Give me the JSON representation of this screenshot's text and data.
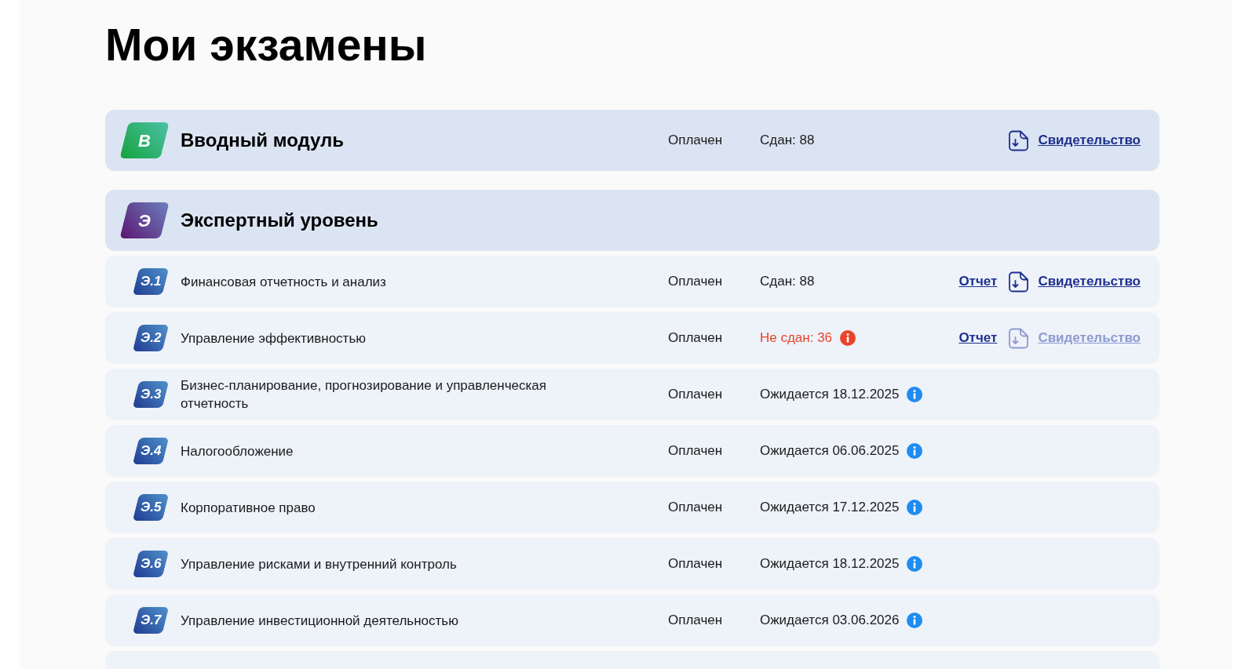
{
  "title": "Мои экзамены",
  "sections": [
    {
      "kind": "module",
      "color": "#16a23e",
      "badge": "В",
      "title": "Вводный модуль",
      "status": "Оплачен",
      "result": {
        "kind": "passed",
        "text": "Сдан: 88"
      },
      "certificate": {
        "label": "Свидетельство",
        "disabled": false
      }
    },
    {
      "kind": "module",
      "color": "#5c1470",
      "badge": "Э",
      "title": "Экспертный уровень"
    },
    {
      "kind": "exam",
      "color": "#1f3a90",
      "badge": "Э.1",
      "title": "Финансовая отчетность и анализ",
      "status": "Оплачен",
      "result": {
        "kind": "passed",
        "text": "Сдан: 88"
      },
      "report": "Отчет",
      "certificate": {
        "label": "Свидетельство",
        "disabled": false
      }
    },
    {
      "kind": "exam",
      "color": "#1f3a90",
      "badge": "Э.2",
      "title": "Управление эффективностью",
      "status": "Оплачен",
      "result": {
        "kind": "failed",
        "text": "Не сдан: 36"
      },
      "report": "Отчет",
      "certificate": {
        "label": "Свидетельство",
        "disabled": true
      }
    },
    {
      "kind": "exam",
      "color": "#1f3a90",
      "badge": "Э.3",
      "title": "Бизнес-планирование, прогнозирование и управленческая отчетность",
      "status": "Оплачен",
      "result": {
        "kind": "pending",
        "text": "Ожидается 18.12.2025"
      }
    },
    {
      "kind": "exam",
      "color": "#1f3a90",
      "badge": "Э.4",
      "title": "Налогообложение",
      "status": "Оплачен",
      "result": {
        "kind": "pending",
        "text": "Ожидается 06.06.2025"
      }
    },
    {
      "kind": "exam",
      "color": "#1f3a90",
      "badge": "Э.5",
      "title": "Корпоративное право",
      "status": "Оплачен",
      "result": {
        "kind": "pending",
        "text": "Ожидается 17.12.2025"
      }
    },
    {
      "kind": "exam",
      "color": "#1f3a90",
      "badge": "Э.6",
      "title": "Управление рисками и внутренний контроль",
      "status": "Оплачен",
      "result": {
        "kind": "pending",
        "text": "Ожидается 18.12.2025"
      }
    },
    {
      "kind": "exam",
      "color": "#1f3a90",
      "badge": "Э.7",
      "title": "Управление инвестиционной деятельностью",
      "status": "Оплачен",
      "result": {
        "kind": "pending",
        "text": "Ожидается 03.06.2026"
      }
    }
  ]
}
